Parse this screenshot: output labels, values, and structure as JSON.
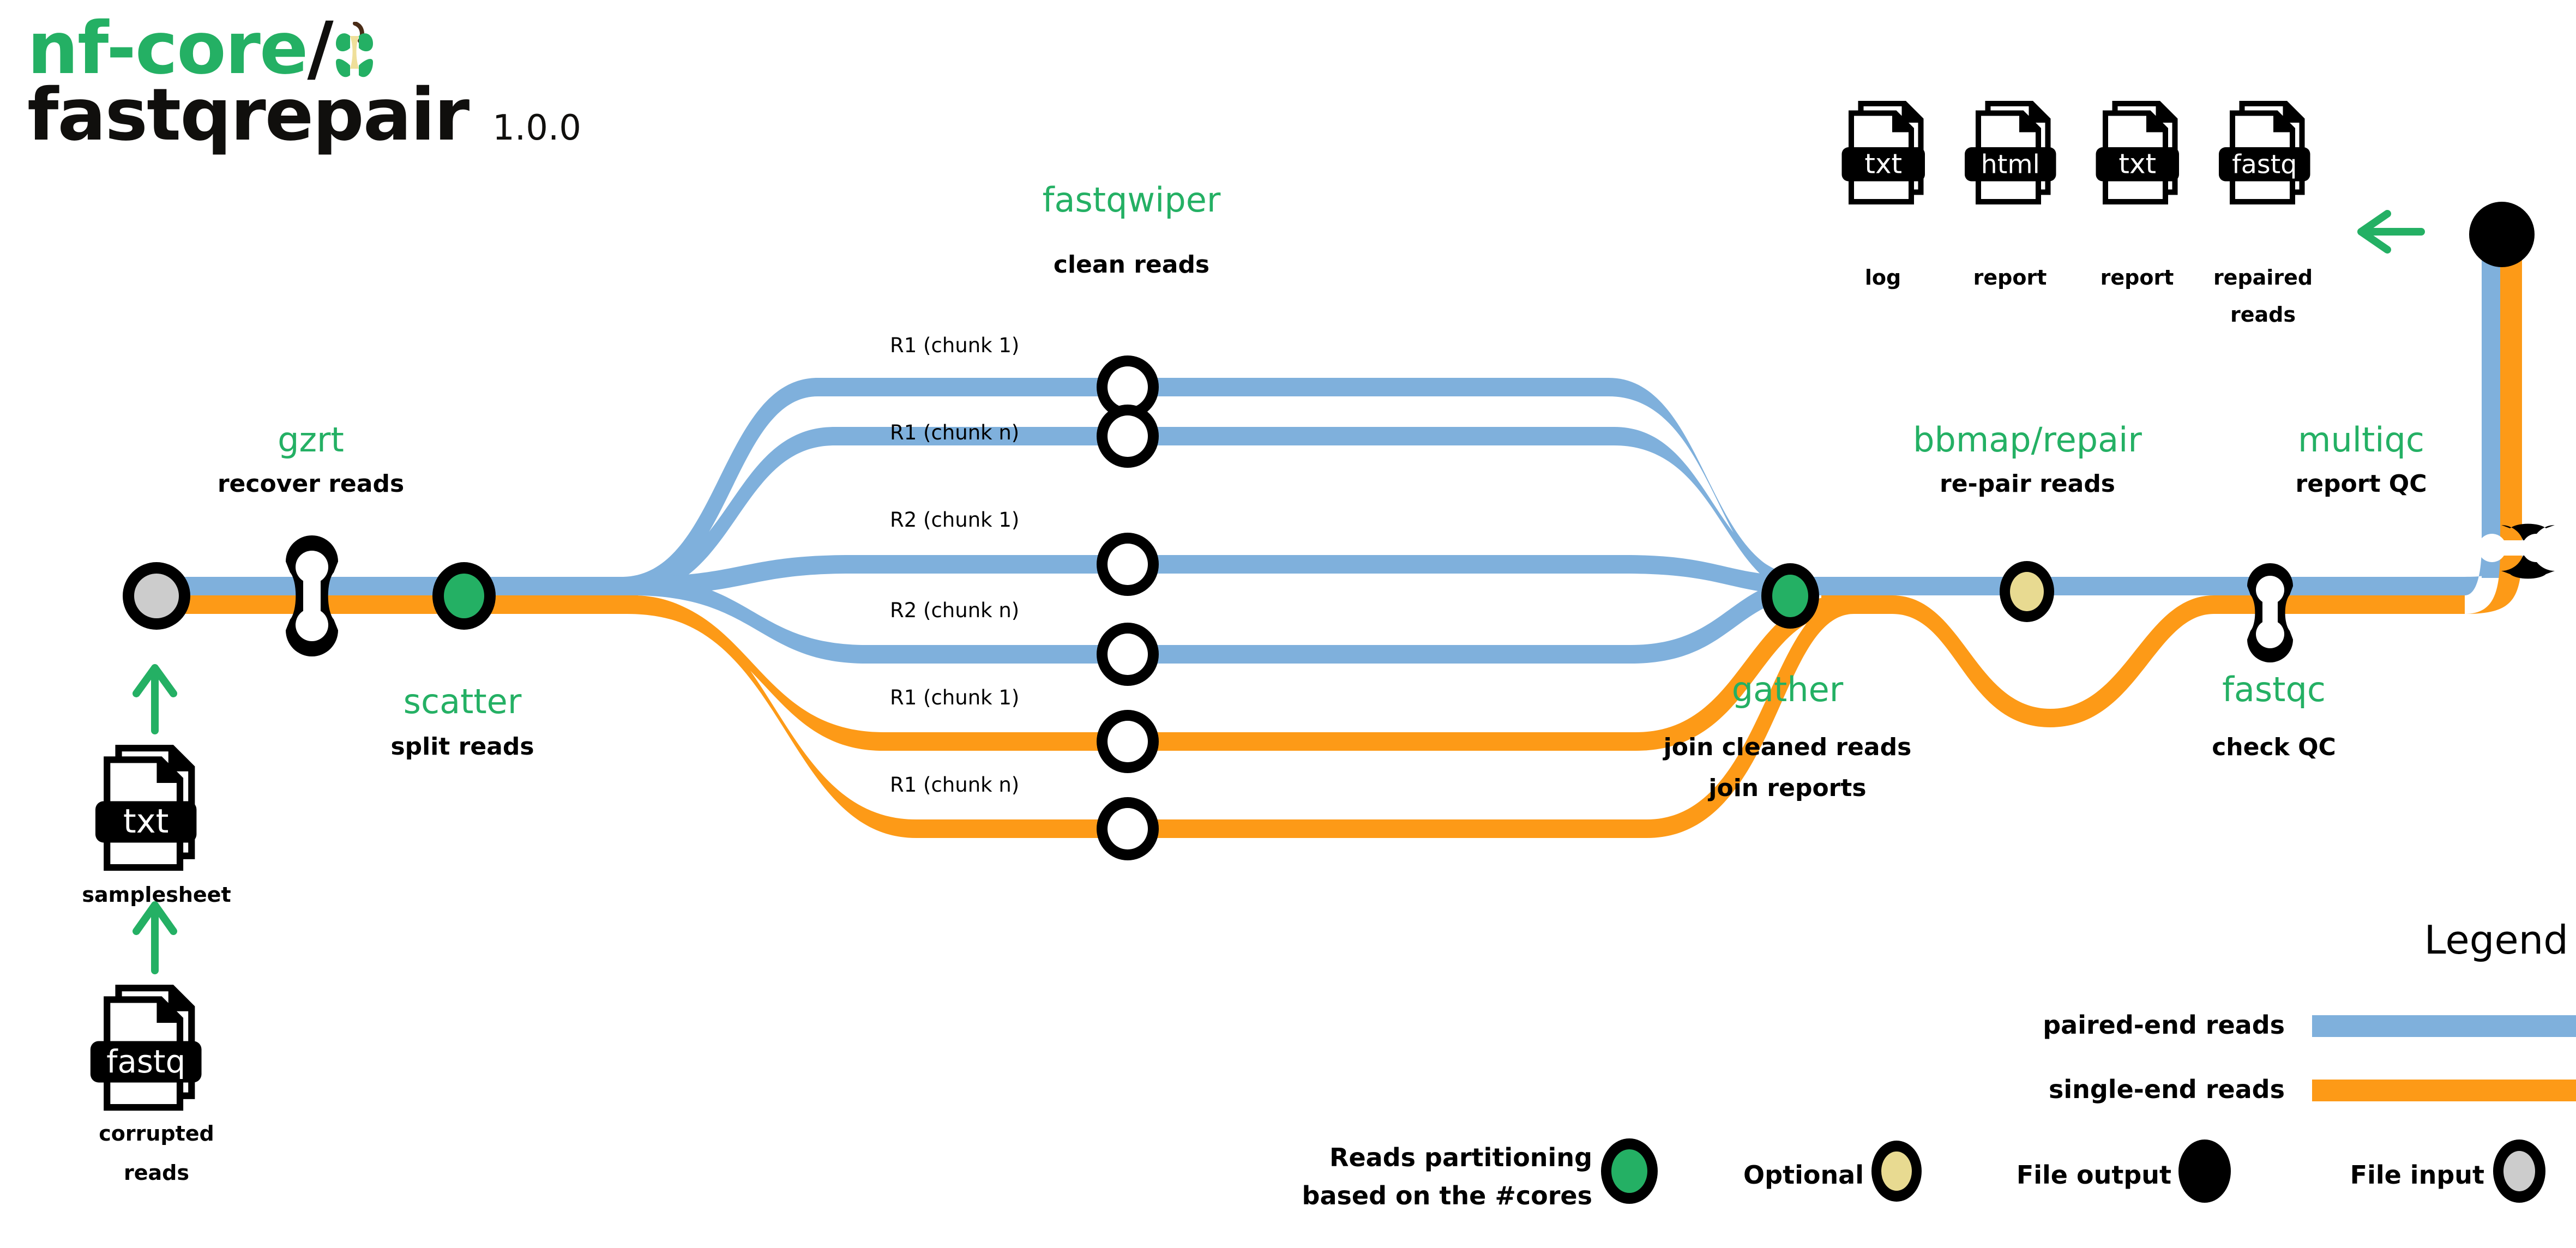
{
  "logo": {
    "prefix_nf": "nf-core",
    "slash": "/",
    "pipeline_name": "fastqrepair",
    "version": "1.0.0",
    "apple_icon": "apple-core-icon",
    "brand_green": "#24B064",
    "brand_black": "#100F0D"
  },
  "colors": {
    "paired_end_blue": "#7FB0DC",
    "single_end_orange": "#FD9A17",
    "process_green": "#24B064",
    "optional_yellow": "#E8DA91",
    "file_input_grey": "#CCCCCC",
    "file_output_black": "#000000",
    "text_black": "#000000"
  },
  "processes": [
    {
      "id": "gzrt",
      "name": "gzrt",
      "desc": "recover reads"
    },
    {
      "id": "scatter",
      "name": "scatter",
      "desc": "split reads"
    },
    {
      "id": "fastqwiper",
      "name": "fastqwiper",
      "desc": "clean reads"
    },
    {
      "id": "gather",
      "name": "gather",
      "desc_line1": "join cleaned reads",
      "desc_line2": "join reports"
    },
    {
      "id": "bbmap_repair",
      "name": "bbmap/repair",
      "desc": "re-pair reads"
    },
    {
      "id": "fastqc",
      "name": "fastqc",
      "desc": "check QC"
    },
    {
      "id": "multiqc",
      "name": "multiqc",
      "desc": "report QC"
    }
  ],
  "chunk_labels": [
    {
      "text": "R1 (chunk 1)",
      "stream": "paired-end"
    },
    {
      "text": "R1 (chunk n)",
      "stream": "paired-end"
    },
    {
      "text": "R2 (chunk 1)",
      "stream": "paired-end"
    },
    {
      "text": "R2 (chunk n)",
      "stream": "paired-end"
    },
    {
      "text": "R1 (chunk 1)",
      "stream": "single-end"
    },
    {
      "text": "R1 (chunk n)",
      "stream": "single-end"
    }
  ],
  "input_files": [
    {
      "ext": "txt",
      "caption": "samplesheet"
    },
    {
      "ext": "fastq",
      "caption_line1": "corrupted",
      "caption_line2": "reads"
    }
  ],
  "output_files": [
    {
      "ext": "txt",
      "caption": "log"
    },
    {
      "ext": "html",
      "caption": "report"
    },
    {
      "ext": "txt",
      "caption": "report"
    },
    {
      "ext": "fastq",
      "caption_line1": "repaired",
      "caption_line2": "reads"
    }
  ],
  "legend": {
    "title": "Legend",
    "streams": [
      {
        "label": "paired-end reads",
        "color": "#7FB0DC"
      },
      {
        "label": "single-end reads",
        "color": "#FD9A17"
      }
    ],
    "nodes": [
      {
        "label_line1": "Reads partitioning",
        "label_line2": "based on the #cores",
        "fill": "#24B064",
        "ring": "#000000"
      },
      {
        "label_line1": "Optional",
        "label_line2": "",
        "fill": "#E8DA91",
        "ring": "#000000"
      },
      {
        "label_line1": "File output",
        "label_line2": "",
        "fill": "#000000",
        "ring": "#000000"
      },
      {
        "label_line1": "File input",
        "label_line2": "",
        "fill": "#CCCCCC",
        "ring": "#000000"
      }
    ]
  },
  "arrows": {
    "samplesheet_up": "arrow-up-icon",
    "corrupted_up": "arrow-up-icon",
    "output_left": "arrow-left-icon"
  }
}
